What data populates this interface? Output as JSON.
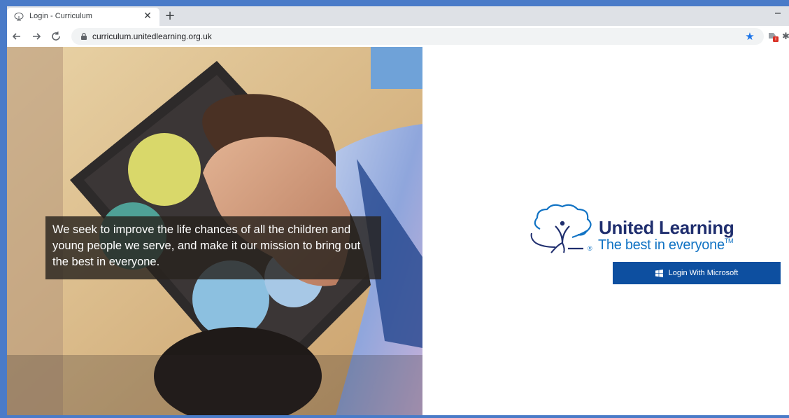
{
  "browser": {
    "tab_title": "Login - Curriculum",
    "tab_close": "✕",
    "new_tab": "+",
    "url": "curriculum.unitedlearning.org.uk",
    "accent": "#1a73e8"
  },
  "page": {
    "caption": "We seek to improve the life chances of all the children and young people we serve, and make it our mission to bring out the best in everyone.",
    "logo": {
      "name": "United Learning",
      "tagline": "The best in everyone",
      "trademark": "TM",
      "registered": "®",
      "colors": {
        "navy": "#1f2e6e",
        "blue": "#1173c4"
      }
    },
    "login_button": {
      "label": "Login With Microsoft",
      "color": "#0d4fa0"
    }
  }
}
